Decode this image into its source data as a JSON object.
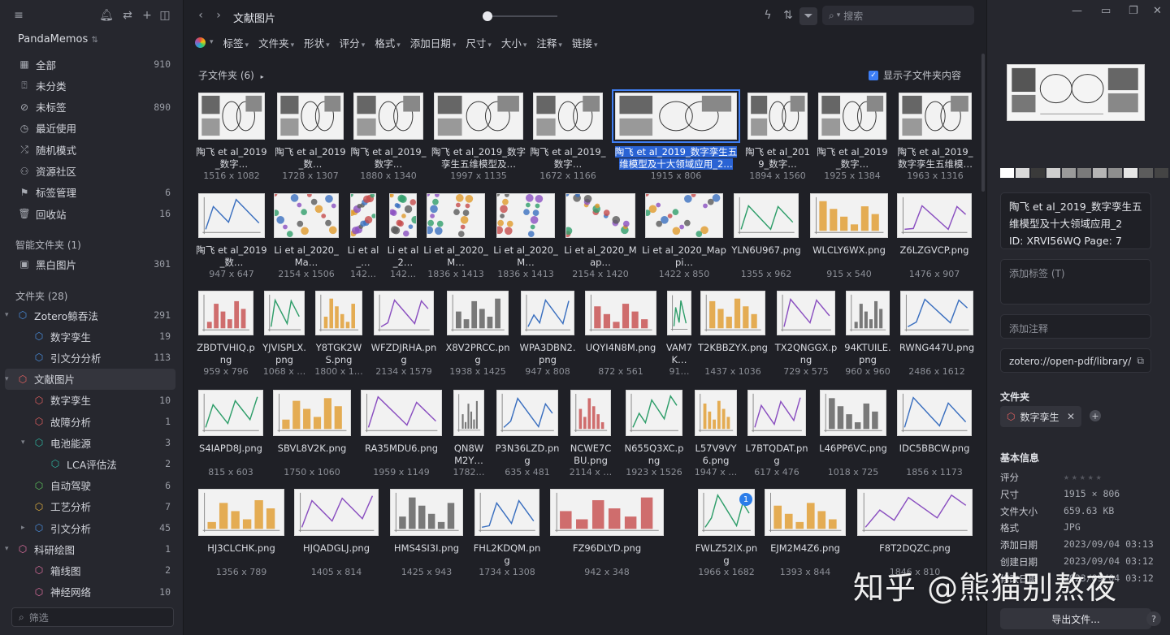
{
  "sidebar": {
    "library_name": "PandaMemos",
    "items": [
      {
        "label": "全部",
        "count": "910",
        "icon": "image-stack-icon"
      },
      {
        "label": "未分类",
        "count": "",
        "icon": "question-box-icon"
      },
      {
        "label": "未标签",
        "count": "890",
        "icon": "tag-off-icon"
      },
      {
        "label": "最近使用",
        "count": "",
        "icon": "clock-icon"
      },
      {
        "label": "随机模式",
        "count": "",
        "icon": "shuffle-icon"
      },
      {
        "label": "资源社区",
        "count": "",
        "icon": "community-icon"
      },
      {
        "label": "标签管理",
        "count": "6",
        "icon": "bookmark-icon"
      },
      {
        "label": "回收站",
        "count": "16",
        "icon": "trash-icon"
      }
    ],
    "smart_header": "智能文件夹 (1)",
    "smart_items": [
      {
        "label": "黑白图片",
        "count": "301"
      }
    ],
    "folders_header": "文件夹 (28)",
    "folders": [
      {
        "label": "Zotero鲸吞法",
        "count": "291",
        "level": 0,
        "caret": "▾"
      },
      {
        "label": "数字孪生",
        "count": "19",
        "level": 1,
        "caret": ""
      },
      {
        "label": "引文分分析",
        "count": "113",
        "level": 1,
        "caret": ""
      },
      {
        "label": "文献图片",
        "count": "",
        "level": 0,
        "caret": "▾",
        "active": true
      },
      {
        "label": "数字孪生",
        "count": "10",
        "level": 1,
        "caret": ""
      },
      {
        "label": "故障分析",
        "count": "1",
        "level": 1,
        "caret": ""
      },
      {
        "label": "电池能源",
        "count": "3",
        "level": 1,
        "caret": "▾"
      },
      {
        "label": "LCA评估法",
        "count": "2",
        "level": 2,
        "caret": ""
      },
      {
        "label": "自动驾驶",
        "count": "6",
        "level": 1,
        "caret": ""
      },
      {
        "label": "工艺分析",
        "count": "7",
        "level": 1,
        "caret": ""
      },
      {
        "label": "引文分析",
        "count": "45",
        "level": 1,
        "caret": "▸"
      },
      {
        "label": "科研绘图",
        "count": "1",
        "level": 0,
        "caret": "▾"
      },
      {
        "label": "箱线图",
        "count": "2",
        "level": 1,
        "caret": ""
      },
      {
        "label": "神经网络",
        "count": "10",
        "level": 1,
        "caret": ""
      }
    ],
    "filter_placeholder": "筛选"
  },
  "main": {
    "title": "文献图片",
    "search_placeholder": "搜索",
    "filters": [
      "标签",
      "文件夹",
      "形状",
      "评分",
      "格式",
      "添加日期",
      "尺寸",
      "大小",
      "注释",
      "链接"
    ],
    "subfolders": "子文件夹 (6)",
    "show_sub": "显示子文件夹内容",
    "rows": [
      [
        {
          "name": "陶飞 et al_2019_数字…",
          "dim": "1516 x 1082"
        },
        {
          "name": "陶飞 et al_2019_数…",
          "dim": "1728 x 1307"
        },
        {
          "name": "陶飞 et al_2019_数字…",
          "dim": "1880 x 1340"
        },
        {
          "name": "陶飞 et al_2019_数字孪生五维模型及…",
          "dim": "1997 x 1135"
        },
        {
          "name": "陶飞 et al_2019_数字…",
          "dim": "1672 x 1166"
        },
        {
          "name": "陶飞 et al_2019_数字孪生五维模型及十大领域应用_2…",
          "dim": "1915 x 806",
          "selected": true
        },
        {
          "name": "陶飞 et al_2019_数字…",
          "dim": "1894 x 1560"
        },
        {
          "name": "陶飞 et al_2019_数字…",
          "dim": "1925 x 1384"
        },
        {
          "name": "陶飞 et al_2019_数字孪生五维模…",
          "dim": "1963 x 1316"
        }
      ],
      [
        {
          "name": "陶飞 et al_2019_数…",
          "dim": "947 x 647"
        },
        {
          "name": "Li et al_2020_Ma…",
          "dim": "2154 x 1506"
        },
        {
          "name": "Li et al_…",
          "dim": "142…"
        },
        {
          "name": "Li et al_2…",
          "dim": "142…"
        },
        {
          "name": "Li et al_2020_M…",
          "dim": "1836 x 1413"
        },
        {
          "name": "Li et al_2020_M…",
          "dim": "1836 x 1413"
        },
        {
          "name": "Li et al_2020_Map…",
          "dim": "2154 x 1420"
        },
        {
          "name": "Li et al_2020_Mappi…",
          "dim": "1422 x 850"
        },
        {
          "name": "YLN6U967.png",
          "dim": "1355 x 962"
        },
        {
          "name": "WLCLY6WX.png",
          "dim": "915 x 540"
        },
        {
          "name": "Z6LZGVCP.png",
          "dim": "1476 x 907"
        }
      ],
      [
        {
          "name": "ZBDTVHIQ.png",
          "dim": "959 x 796"
        },
        {
          "name": "YJVISPLX.png",
          "dim": "1068 x …"
        },
        {
          "name": "Y8TGK2WS.png",
          "dim": "1800 x 1…"
        },
        {
          "name": "WFZDJRHA.png",
          "dim": "2134 x 1579"
        },
        {
          "name": "X8V2PRCC.png",
          "dim": "1938 x 1425"
        },
        {
          "name": "WPA3DBN2.png",
          "dim": "947 x 808"
        },
        {
          "name": "UQYI4N8M.png",
          "dim": "872 x 561"
        },
        {
          "name": "VAM7K…",
          "dim": "91…"
        },
        {
          "name": "T2KBBZYX.png",
          "dim": "1437 x 1036"
        },
        {
          "name": "TX2QNGGX.png",
          "dim": "729 x 575"
        },
        {
          "name": "94KTUILE.png",
          "dim": "960 x 960"
        },
        {
          "name": "RWNG447U.png",
          "dim": "2486 x 1612"
        }
      ],
      [
        {
          "name": "S4IAPD8J.png",
          "dim": "815 x 603"
        },
        {
          "name": "SBVL8V2K.png",
          "dim": "1750 x 1060"
        },
        {
          "name": "RA35MDU6.png",
          "dim": "1959 x 1149"
        },
        {
          "name": "QN8WM2Y…",
          "dim": "1782…"
        },
        {
          "name": "P3N36LZD.png",
          "dim": "635 x 481"
        },
        {
          "name": "NCWE7CBU.png",
          "dim": "2114 x …"
        },
        {
          "name": "N655Q3XC.png",
          "dim": "1923 x 1526"
        },
        {
          "name": "L57V9VY6.png",
          "dim": "1947 x …"
        },
        {
          "name": "L7BTQDAT.png",
          "dim": "617 x 476"
        },
        {
          "name": "L46PP6VC.png",
          "dim": "1018 x 725"
        },
        {
          "name": "IDC5BBCW.png",
          "dim": "1856 x 1173"
        }
      ],
      [
        {
          "name": "HJ3CLCHK.png",
          "dim": "1356 x 789"
        },
        {
          "name": "HJQADGLJ.png",
          "dim": "1405 x 814"
        },
        {
          "name": "HMS4SI3I.png",
          "dim": "1425 x 943"
        },
        {
          "name": "FHL2KDQM.png",
          "dim": "1734 x 1308"
        },
        {
          "name": "FZ96DLYD.png",
          "dim": "942 x 348"
        },
        {
          "name": "FWLZ52IX.png",
          "dim": "1966 x 1682",
          "badge": "1"
        },
        {
          "name": "EJM2M4Z6.png",
          "dim": "1393 x 844"
        },
        {
          "name": "F8T2DQZC.png",
          "dim": "1846 x 810"
        }
      ]
    ]
  },
  "inspector": {
    "title": "陶飞 et al_2019_数字孪生五维模型及十大领域应用_2",
    "id_line": "ID: XRVI56WQ Page: 7",
    "tag_placeholder": "添加标签 (T)",
    "note_placeholder": "添加注释",
    "link": "zotero://open-pdf/library/",
    "folders_label": "文件夹",
    "folder_chip": "数字孪生",
    "basic_label": "基本信息",
    "info": [
      {
        "k": "评分",
        "v": "★★★★★"
      },
      {
        "k": "尺寸",
        "v": "1915 × 806"
      },
      {
        "k": "文件大小",
        "v": "659.63 KB"
      },
      {
        "k": "格式",
        "v": "JPG"
      },
      {
        "k": "添加日期",
        "v": "2023/09/04 03:13"
      },
      {
        "k": "创建日期",
        "v": "2023/09/04 03:12"
      },
      {
        "k": "修改日期",
        "v": "2023/09/04 03:12"
      }
    ],
    "export": "导出文件...",
    "swatches": [
      "#ffffff",
      "#d9d9d9",
      "#3a3a3a",
      "#cfcfcf",
      "#9a9a9a",
      "#7a7a7a",
      "#b5b5b5",
      "#8e8e8e",
      "#e6e6e6",
      "#5c5c5c",
      "#444444"
    ]
  },
  "watermark": "知乎 @熊猫别熬夜",
  "colors": {
    "accent": "#3d7ef5",
    "bg": "#1f2026",
    "sidebar": "#26272e"
  }
}
